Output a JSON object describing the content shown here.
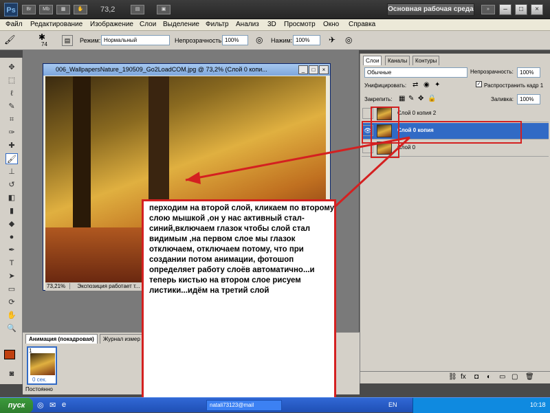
{
  "appbar": {
    "logo": "Ps",
    "icon_br": "Br",
    "icon_mb": "Mb",
    "zoom": "73,2",
    "workspace": "Основная рабочая среда",
    "min": "–",
    "max": "□",
    "close": "×"
  },
  "menu": [
    "Файл",
    "Редактирование",
    "Изображение",
    "Слои",
    "Выделение",
    "Фильтр",
    "Анализ",
    "3D",
    "Просмотр",
    "Окно",
    "Справка"
  ],
  "options": {
    "brush_size": "74",
    "mode_label": "Режим:",
    "mode_value": "Нормальный",
    "opacity_label": "Непрозрачность:",
    "opacity_value": "100%",
    "flow_label": "Нажим:",
    "flow_value": "100%"
  },
  "document": {
    "title": "006_WallpapersNature_190509_Go2LoadCOM.jpg @ 73,2% (Слой 0 копи...",
    "zoom": "73,21%",
    "status": "Экспозиция работает т..."
  },
  "animation": {
    "tab1": "Анимация (покадровая)",
    "tab2": "Журнал измер",
    "frame_num": "1",
    "frame_time": "0 сек.",
    "loop": "Постоянно"
  },
  "layers": {
    "tabs": [
      "Слои",
      "Каналы",
      "Контуры"
    ],
    "blend": "Обычные",
    "opacity_label": "Непрозрачность:",
    "opacity_value": "100%",
    "unify_label": "Унифицировать:",
    "propagate_label": "Распространить кадр 1",
    "lock_label": "Закрепить:",
    "fill_label": "Заливка:",
    "fill_value": "100%",
    "items": [
      {
        "name": "Слой 0 копия 2"
      },
      {
        "name": "Слой 0 копия"
      },
      {
        "name": "Слой 0"
      }
    ]
  },
  "taskbar": {
    "user": "natali73123@mail",
    "lang": "EN",
    "clock": "10:18"
  },
  "annotation": "перходим на второй слой, кликаем по второму слою мышкой ,он у нас активный стал- синий,включаем глазок чтобы слой стал видимым ,на первом слое мы глазок отключаем, отключаем  потому, что при создании потом анимации, фотошоп определяет работу слоёв автоматично...и теперь кистью на втором слое рисуем листики...идём на третий слой",
  "colors": {
    "accent": "#316ac5",
    "annotation_red": "#d42020",
    "foreground_swatch": "#c04010"
  }
}
